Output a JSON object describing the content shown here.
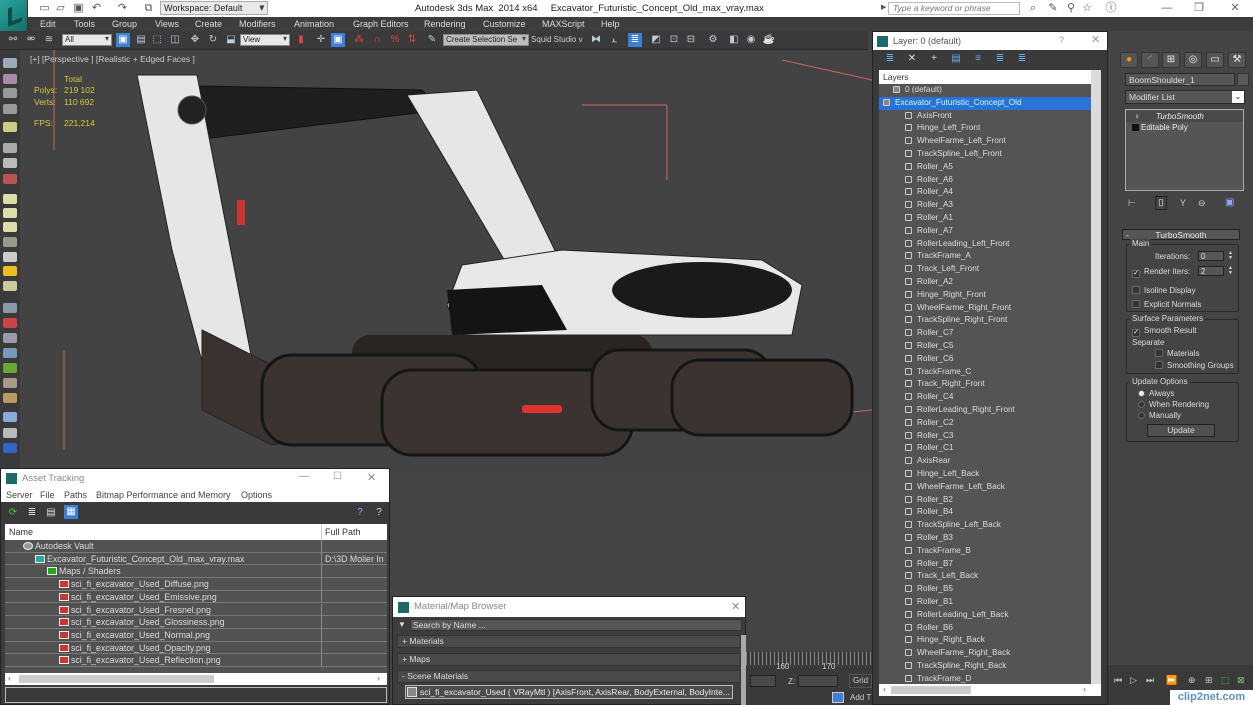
{
  "app": {
    "title": "Autodesk 3ds Max  2014 x64     Excavator_Futuristic_Concept_Old_max_vray.max",
    "workspace": "Workspace: Default",
    "search_placeholder": "Type a keyword or phrase"
  },
  "menu": [
    "Edit",
    "Tools",
    "Group",
    "Views",
    "Create",
    "Modifiers",
    "Animation",
    "Graph Editors",
    "Rendering",
    "Customize",
    "MAXScript",
    "Help"
  ],
  "toolbar": {
    "selection_filter": "All",
    "ref_coord": "View",
    "named_selection": "Create Selection Se",
    "squid_label": "Squid Studio v"
  },
  "viewport": {
    "label": "[+] [Perspective ] [Realistic + Edged Faces ]",
    "stats": {
      "header": "Total",
      "polys_label": "Polys:",
      "polys": "219 102",
      "verts_label": "Verts:",
      "verts": "110 692",
      "fps_label": "FPS:",
      "fps": "221,214"
    }
  },
  "layer_window": {
    "title": "Layer: 0 (default)",
    "help": "?",
    "header": "Layers",
    "layers": [
      {
        "name": "0 (default)",
        "type": "layer",
        "selected": false
      },
      {
        "name": "Excavator_Futuristic_Concept_Old",
        "type": "layer",
        "selected": true
      }
    ],
    "objects": [
      "AxisFront",
      "Hinge_Left_Front",
      "WheelFarme_Left_Front",
      "TrackSpline_Left_Front",
      "Roller_A5",
      "Roller_A6",
      "Roller_A4",
      "Roller_A3",
      "Roller_A1",
      "Roller_A7",
      "RollerLeading_Left_Front",
      "TrackFrame_A",
      "Track_Left_Front",
      "Roller_A2",
      "Hinge_Right_Front",
      "WheelFarme_Right_Front",
      "TrackSpline_Right_Front",
      "Roller_C7",
      "Roller_C5",
      "Roller_C6",
      "TrackFrame_C",
      "Track_Right_Front",
      "Roller_C4",
      "RollerLeading_Right_Front",
      "Roller_C2",
      "Roller_C3",
      "Roller_C1",
      "AxisRear",
      "Hinge_Left_Back",
      "WheelFarme_Left_Back",
      "Roller_B2",
      "Roller_B4",
      "TrackSpline_Left_Back",
      "Roller_B3",
      "TrackFrame_B",
      "Roller_B7",
      "Track_Left_Back",
      "Roller_B5",
      "Roller_B1",
      "RollerLeading_Left_Back",
      "Roller_B6",
      "Hinge_Right_Back",
      "WheelFarme_Right_Back",
      "TrackSpline_Right_Back",
      "TrackFrame_D"
    ]
  },
  "command_panel": {
    "object_name": "BoomShoulder_1",
    "modifier_list": "Modifier List",
    "stack": [
      {
        "name": "TurboSmooth",
        "italic": true
      },
      {
        "name": "Editable Poly",
        "italic": false
      }
    ],
    "turbosmooth": {
      "title": "TurboSmooth",
      "main_label": "Main",
      "iterations_label": "Iterations:",
      "iterations": "0",
      "render_iters_label": "Render Iters:",
      "render_iters": "2",
      "render_iters_checked": true,
      "isoline_display": "Isoline Display",
      "isoline_checked": false,
      "explicit_normals": "Explicit Normals",
      "explicit_checked": false,
      "surface_params": "Surface Parameters",
      "smooth_result": "Smooth Result",
      "smooth_result_checked": true,
      "separate": "Separate",
      "materials": "Materials",
      "materials_checked": false,
      "smoothing_groups": "Smoothing Groups",
      "smoothing_checked": false,
      "update_options": "Update Options",
      "always": "Always",
      "when_rendering": "When Rendering",
      "manually": "Manually",
      "selected_update": "Always",
      "update_button": "Update"
    }
  },
  "asset_tracking": {
    "title": "Asset Tracking",
    "menu": [
      "Server",
      "File",
      "Paths",
      "Bitmap Performance and Memory",
      "Options"
    ],
    "columns": [
      "Name",
      "Full Path"
    ],
    "rows": [
      {
        "name": "Autodesk Vault",
        "path": "",
        "indent": 1,
        "icon": "vault"
      },
      {
        "name": "Excavator_Futuristic_Concept_Old_max_vray.max",
        "path": "D:\\3D Molier In",
        "indent": 2,
        "icon": "max-file"
      },
      {
        "name": "Maps / Shaders",
        "path": "",
        "indent": 3,
        "icon": "maps"
      },
      {
        "name": "sci_fi_excavator_Used_Diffuse.png",
        "path": "",
        "indent": 4,
        "icon": "png"
      },
      {
        "name": "sci_fi_excavator_Used_Emissive.png",
        "path": "",
        "indent": 4,
        "icon": "png"
      },
      {
        "name": "sci_fi_excavator_Used_Fresnel.png",
        "path": "",
        "indent": 4,
        "icon": "png"
      },
      {
        "name": "sci_fi_excavator_Used_Glossiness.png",
        "path": "",
        "indent": 4,
        "icon": "png"
      },
      {
        "name": "sci_fi_excavator_Used_Normal.png",
        "path": "",
        "indent": 4,
        "icon": "png"
      },
      {
        "name": "sci_fi_excavator_Used_Opacity.png",
        "path": "",
        "indent": 4,
        "icon": "png"
      },
      {
        "name": "sci_fi_excavator_Used_Reflection.png",
        "path": "",
        "indent": 4,
        "icon": "png"
      }
    ]
  },
  "material_browser": {
    "title": "Material/Map Browser",
    "search_placeholder": "Search by Name ...",
    "categories": [
      "+ Materials",
      "+ Maps",
      "- Scene Materials"
    ],
    "scene_material": "sci_fi_excavator_Used  ( VRayMtl ) [AxisFront, AxisRear, BodyExternal, BodyInte..."
  },
  "timeline": {
    "ticks": [
      "160",
      "170"
    ],
    "z_label": "Z:",
    "grid_label": "Grid =",
    "add_label": "Add T"
  },
  "watermark": "clip2net.com",
  "colors": {
    "selection_blue": "#2a72d8",
    "stats_yellow": "#d8c93a",
    "viewport_bg": "#434343"
  }
}
